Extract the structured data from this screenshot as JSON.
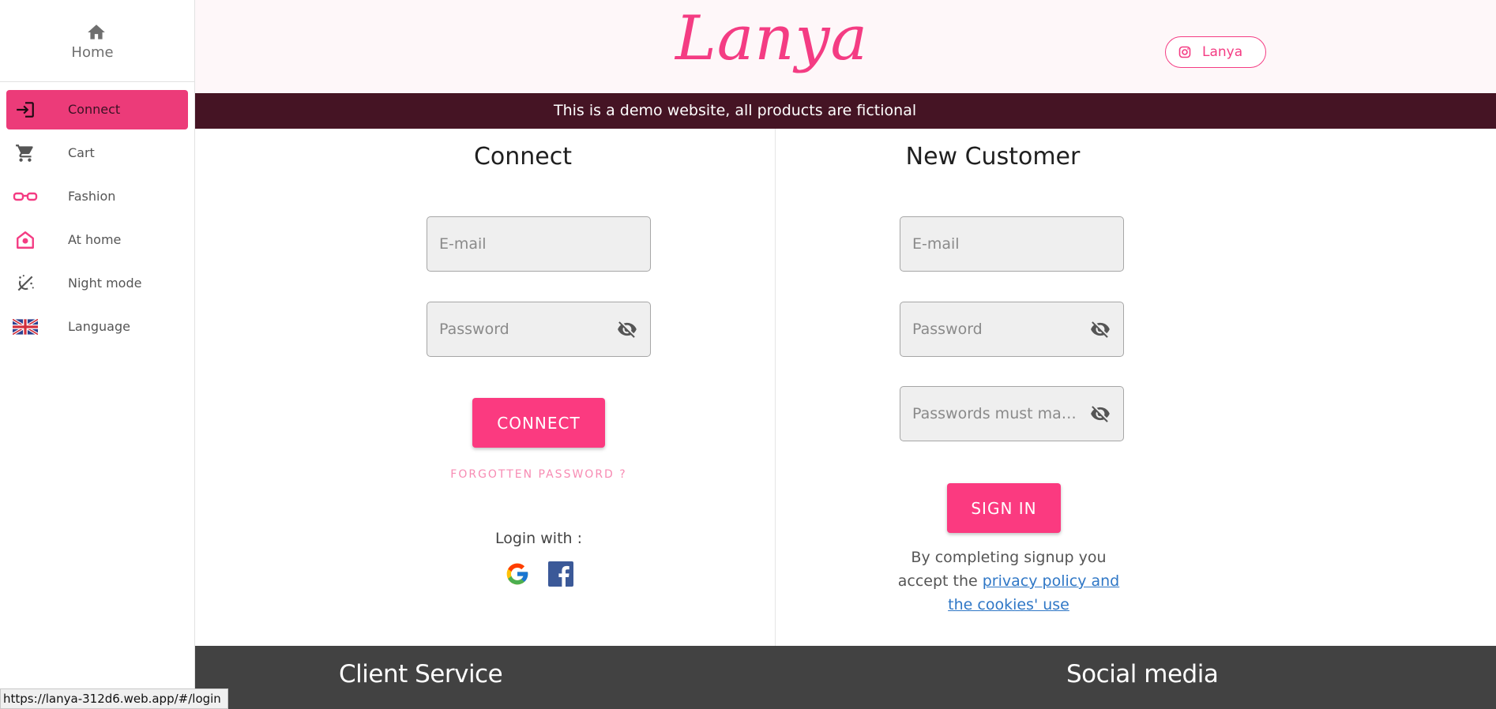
{
  "sidebar": {
    "home_label": "Home",
    "items": [
      {
        "label": "Connect",
        "icon": "login-icon",
        "active": true
      },
      {
        "label": "Cart",
        "icon": "cart-icon",
        "active": false
      },
      {
        "label": "Fashion",
        "icon": "glasses-icon",
        "active": false
      },
      {
        "label": "At home",
        "icon": "house-icon",
        "active": false
      },
      {
        "label": "Night mode",
        "icon": "night-mode-icon",
        "active": false
      },
      {
        "label": "Language",
        "icon": "uk-flag-icon",
        "active": false
      }
    ]
  },
  "header": {
    "logo": "Lanya",
    "instagram_label": "Lanya",
    "banner": "This is a demo website, all products are fictional"
  },
  "connect": {
    "title": "Connect",
    "email_placeholder": "E-mail",
    "password_placeholder": "Password",
    "button": "CONNECT",
    "forgot": "FORGOTTEN PASSWORD ?",
    "login_with": "Login with :"
  },
  "signup": {
    "title": "New Customer",
    "email_placeholder": "E-mail",
    "password_placeholder": "Password",
    "confirm_placeholder": "Passwords must ma…",
    "button": "SIGN IN",
    "terms_prefix": "By completing signup you accept the ",
    "terms_link": "privacy policy and the cookies' use"
  },
  "footer": {
    "client_service": "Client Service",
    "social_media": "Social media"
  },
  "status_url": "https://lanya-312d6.web.app/#/login",
  "colors": {
    "accent": "#fb3a80",
    "banner": "#451424",
    "footer": "#424242",
    "header_bg": "#fef7f9"
  }
}
